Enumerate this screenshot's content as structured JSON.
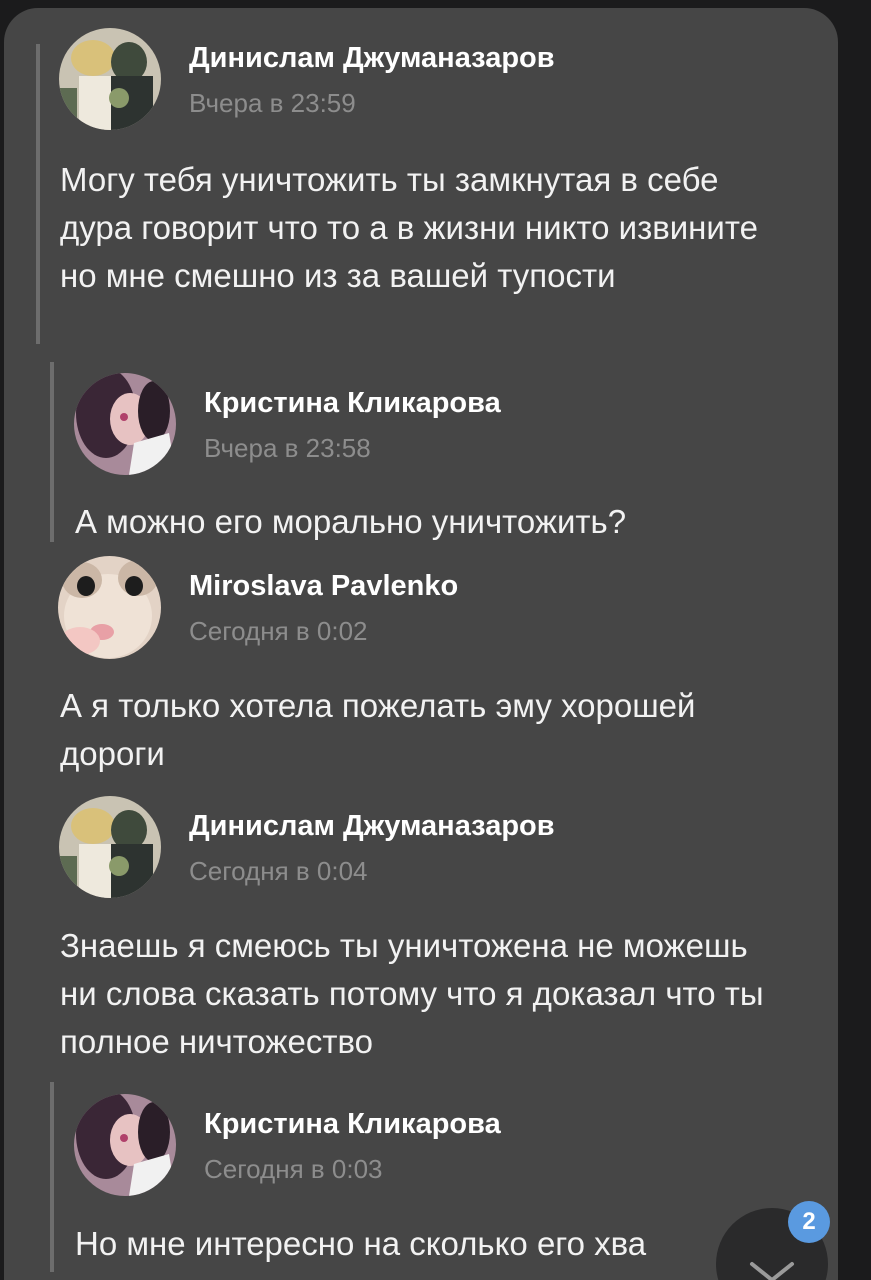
{
  "comments": [
    {
      "author": "Динислам Джуманазаров",
      "time": "Вчера в 23:59",
      "text": "Могу тебя уничтожить ты замкнутая в себе дура говорит что то а в жизни никто извините но мне смешно из за вашей тупости",
      "reply_to": {
        "author": "Кристина Кликарова",
        "time": "Вчера в 23:58",
        "text": "А можно его морально уничтожить?"
      }
    },
    {
      "author": "Miroslava Pavlenko",
      "time": "Сегодня в 0:02",
      "text": "А я только хотела пожелать эму хорошей дороги"
    },
    {
      "author": "Динислам Джуманазаров",
      "time": "Сегодня в 0:04",
      "text": "Знаешь я смеюсь ты уничтожена не можешь ни слова сказать потому что я доказал что ты полное ничтожество",
      "reply_to": {
        "author": "Кристина Кликарова",
        "time": "Сегодня в 0:03",
        "text": "Но мне интересно на сколько его хва"
      }
    }
  ],
  "scroll_down": {
    "badge_count": "2",
    "icon": "chevron-down-icon"
  },
  "colors": {
    "card_bg": "#464646",
    "page_bg": "#1b1b1c",
    "badge": "#5a9ae0",
    "time_text": "#8d8d8d"
  }
}
